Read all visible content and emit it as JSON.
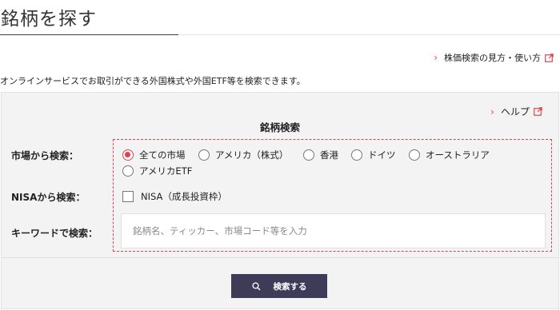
{
  "page": {
    "title": "銘柄を探す",
    "guide_link": "株価検索の見方・使い方",
    "description": "オンラインサービスでお取引ができる外国株式や外国ETF等を検索できます。"
  },
  "panel": {
    "help_link": "ヘルプ",
    "title": "銘柄検索",
    "market": {
      "label": "市場から検索：",
      "options": [
        "全ての市場",
        "アメリカ（株式）",
        "香港",
        "ドイツ",
        "オーストラリア",
        "アメリカETF"
      ],
      "selected": "全ての市場"
    },
    "nisa": {
      "label": "NISAから検索：",
      "checkbox_label": "NISA（成長投資枠）",
      "checked": false
    },
    "keyword": {
      "label": "キーワードで検索：",
      "placeholder": "銘柄名、ティッカー、市場コード等を入力",
      "value": ""
    },
    "search_button": "検索する"
  },
  "colors": {
    "accent": "#e0434f",
    "button": "#3e3b59",
    "panel_bg": "#f3f3f3"
  },
  "icons": {
    "external": "external-link-icon",
    "chevron": "chevron-right-icon",
    "search": "search-icon"
  }
}
